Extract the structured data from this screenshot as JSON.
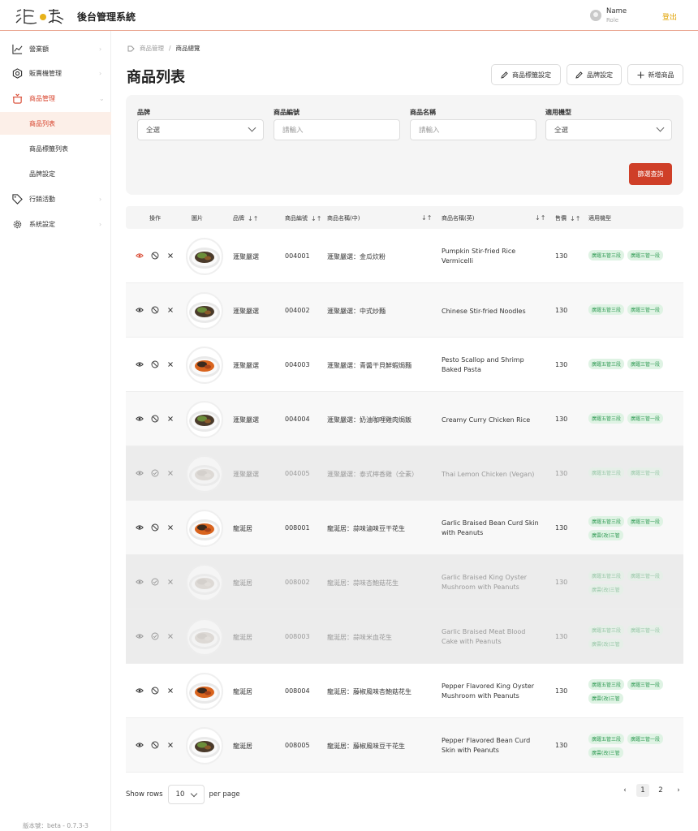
{
  "header": {
    "logo_text": "滙聚",
    "app_title": "後台管理系統",
    "user_name": "Name",
    "user_role": "Role",
    "logout_label": "登出"
  },
  "sidebar": {
    "items": [
      {
        "label": "營業額",
        "icon": "chart-line-icon"
      },
      {
        "label": "販賣機管理",
        "icon": "hexagon-gear-icon"
      },
      {
        "label": "商品管理",
        "icon": "pot-icon"
      },
      {
        "label": "行銷活動",
        "icon": "tag-icon"
      },
      {
        "label": "系統設定",
        "icon": "gear-icon"
      }
    ],
    "subitems": [
      {
        "label": "商品列表"
      },
      {
        "label": "商品標籤列表"
      },
      {
        "label": "品牌設定"
      }
    ],
    "version": "版本號：beta - 0.7.3-3"
  },
  "breadcrumb": {
    "parent": "商品管理",
    "current": "商品總覽"
  },
  "page_title": "商品列表",
  "toolbar": {
    "tag_settings": "商品標籤設定",
    "brand_settings": "品牌設定",
    "add_product": "新增商品"
  },
  "filters": {
    "brand_label": "品牌",
    "brand_value": "全選",
    "code_label": "商品編號",
    "code_placeholder": "請輸入",
    "name_label": "商品名稱",
    "name_placeholder": "請輸入",
    "model_label": "適用機型",
    "model_value": "全選",
    "search_label": "篩選查詢"
  },
  "table": {
    "headers": {
      "actions": "操作",
      "image": "圖片",
      "brand": "品牌",
      "code": "商品編號",
      "name_zh": "商品名稱(中)",
      "name_en": "商品名稱(英)",
      "price": "售價",
      "models": "適用機型"
    },
    "rows": [
      {
        "brand": "滙聚嚴選",
        "code": "004001",
        "name_zh": "滙聚嚴選：金瓜炊粉",
        "name_en": "Pumpkin Stir-fried Rice Vermicelli",
        "price": "130",
        "tags": [
          "廣躍五管三段",
          "廣躍三管一段"
        ],
        "status": "active",
        "dish": "green"
      },
      {
        "brand": "滙聚嚴選",
        "code": "004002",
        "name_zh": "滙聚嚴選：中式炒麵",
        "name_en": "Chinese Stir-fried Noodles",
        "price": "130",
        "tags": [
          "廣躍五管三段",
          "廣躍三管一段"
        ],
        "status": "normal",
        "dish": "green"
      },
      {
        "brand": "滙聚嚴選",
        "code": "004003",
        "name_zh": "滙聚嚴選：青醬干貝鮮蝦焗麵",
        "name_en": "Pesto Scallop and Shrimp Baked Pasta",
        "price": "130",
        "tags": [
          "廣躍五管三段",
          "廣躍三管一段"
        ],
        "status": "normal",
        "dish": "orange"
      },
      {
        "brand": "滙聚嚴選",
        "code": "004004",
        "name_zh": "滙聚嚴選：奶油咖哩雞肉焗飯",
        "name_en": "Creamy Curry Chicken Rice",
        "price": "130",
        "tags": [
          "廣躍五管三段",
          "廣躍三管一段"
        ],
        "status": "normal",
        "dish": "green"
      },
      {
        "brand": "滙聚嚴選",
        "code": "004005",
        "name_zh": "滙聚嚴選：泰式檸香雞（全素）",
        "name_en": "Thai Lemon Chicken (Vegan)",
        "price": "130",
        "tags": [
          "廣躍五管三段",
          "廣躍三管一段"
        ],
        "status": "disabled",
        "dish": "pale"
      },
      {
        "brand": "龍涎居",
        "code": "008001",
        "name_zh": "龍涎居：蒜味滷味豆干花生",
        "name_en": "Garlic Braised Bean Curd Skin with Peanuts",
        "price": "130",
        "tags": [
          "廣躍五管三段",
          "廣躍三管一段",
          "廣雲(改)三管"
        ],
        "status": "normal",
        "dish": "orange"
      },
      {
        "brand": "龍涎居",
        "code": "008002",
        "name_zh": "龍涎居：蒜味杏鮑菇花生",
        "name_en": "Garlic Braised King Oyster Mushroom with Peanuts",
        "price": "130",
        "tags": [
          "廣躍五管三段",
          "廣躍三管一段",
          "廣雲(改)三管"
        ],
        "status": "disabled",
        "dish": "pale"
      },
      {
        "brand": "龍涎居",
        "code": "008003",
        "name_zh": "龍涎居：蒜味米血花生",
        "name_en": "Garlic Braised Meat Blood Cake with Peanuts",
        "price": "130",
        "tags": [
          "廣躍五管三段",
          "廣躍三管一段",
          "廣雲(改)三管"
        ],
        "status": "disabled",
        "dish": "pale"
      },
      {
        "brand": "龍涎居",
        "code": "008004",
        "name_zh": "龍涎居：藤椒風味杏鮑菇花生",
        "name_en": "Pepper Flavored King Oyster Mushroom with Peanuts",
        "price": "130",
        "tags": [
          "廣躍五管三段",
          "廣躍三管一段",
          "廣雲(改)三管"
        ],
        "status": "normal",
        "dish": "orange"
      },
      {
        "brand": "龍涎居",
        "code": "008005",
        "name_zh": "龍涎居：藤椒風味豆干花生",
        "name_en": "Pepper Flavored Bean Curd Skin with Peanuts",
        "price": "130",
        "tags": [
          "廣躍五管三段",
          "廣躍三管一段",
          "廣雲(改)三管"
        ],
        "status": "normal",
        "dish": "green"
      }
    ]
  },
  "pagination": {
    "show_rows": "Show rows",
    "rows_value": "10",
    "per_page": "per page",
    "pages": [
      "1",
      "2"
    ],
    "current": "1",
    "prev": "‹",
    "next": "›"
  },
  "colors": {
    "accent": "#cf3f28",
    "tag_bg": "#dff3e4",
    "tag_text": "#2e9a52",
    "logout": "#e0a200"
  }
}
